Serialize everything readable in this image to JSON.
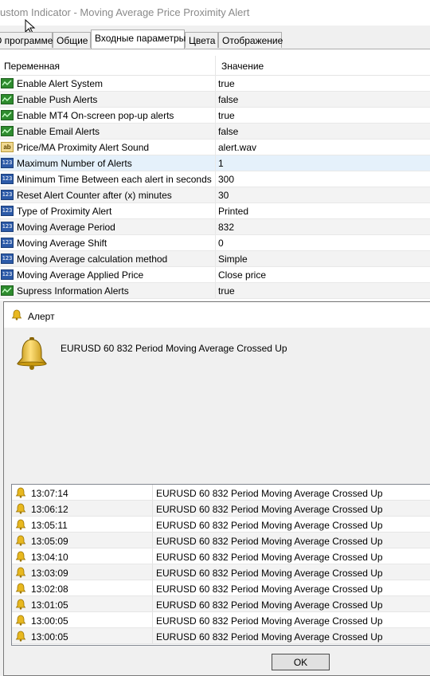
{
  "window": {
    "title": "ustom Indicator - Moving Average Price Proximity Alert"
  },
  "tabs": [
    {
      "label": "О программе"
    },
    {
      "label": "Общие"
    },
    {
      "label": "Входные параметры"
    },
    {
      "label": "Цвета"
    },
    {
      "label": "Отображение"
    }
  ],
  "grid": {
    "col_variable": "Переменная",
    "col_value": "Значение",
    "rows": [
      {
        "name": "Enable Alert System",
        "value": "true",
        "type": "bool"
      },
      {
        "name": "Enable Push Alerts",
        "value": "false",
        "type": "bool"
      },
      {
        "name": "Enable MT4 On-screen pop-up alerts",
        "value": "true",
        "type": "bool"
      },
      {
        "name": "Enable Email Alerts",
        "value": "false",
        "type": "bool"
      },
      {
        "name": "Price/MA Proximity Alert Sound",
        "value": "alert.wav",
        "type": "string"
      },
      {
        "name": "Maximum Number of Alerts",
        "value": "1",
        "type": "int"
      },
      {
        "name": "Minimum Time Between each alert in seconds",
        "value": "300",
        "type": "int"
      },
      {
        "name": "Reset Alert Counter after (x) minutes",
        "value": "30",
        "type": "int"
      },
      {
        "name": "Type of Proximity Alert",
        "value": "Printed",
        "type": "int"
      },
      {
        "name": "Moving Average Period",
        "value": "832",
        "type": "int"
      },
      {
        "name": "Moving Average Shift",
        "value": "0",
        "type": "int"
      },
      {
        "name": "Moving Average calculation method",
        "value": "Simple",
        "type": "int"
      },
      {
        "name": "Moving Average Applied Price",
        "value": "Close price",
        "type": "int"
      },
      {
        "name": "Supress Information Alerts",
        "value": "true",
        "type": "bool"
      }
    ],
    "icons": {
      "bool": "bool-param-icon",
      "int": "int-param-icon",
      "string": "string-param-icon"
    }
  },
  "alert": {
    "title": "Алерт",
    "message": "EURUSD 60 832 Period Moving Average Crossed Up",
    "history": [
      {
        "time": "13:07:14",
        "message": "EURUSD 60 832 Period Moving Average Crossed Up"
      },
      {
        "time": "13:06:12",
        "message": "EURUSD 60 832 Period Moving Average Crossed Up"
      },
      {
        "time": "13:05:11",
        "message": "EURUSD 60 832 Period Moving Average Crossed Up"
      },
      {
        "time": "13:05:09",
        "message": "EURUSD 60 832 Period Moving Average Crossed Up"
      },
      {
        "time": "13:04:10",
        "message": "EURUSD 60 832 Period Moving Average Crossed Up"
      },
      {
        "time": "13:03:09",
        "message": "EURUSD 60 832 Period Moving Average Crossed Up"
      },
      {
        "time": "13:02:08",
        "message": "EURUSD 60 832 Period Moving Average Crossed Up"
      },
      {
        "time": "13:01:05",
        "message": "EURUSD 60 832 Period Moving Average Crossed Up"
      },
      {
        "time": "13:00:05",
        "message": "EURUSD 60 832 Period Moving Average Crossed Up"
      },
      {
        "time": "13:00:05",
        "message": "EURUSD 60 832 Period Moving Average Crossed Up"
      }
    ],
    "ok_label": "OK",
    "bell_icon": "bell-icon"
  },
  "colors": {
    "selected_row": "#e5f1fb",
    "alt_row": "#f3f3f3",
    "bool_icon": "#2e8b2e",
    "int_icon": "#2c5aa8",
    "bell": "#e8b820"
  }
}
